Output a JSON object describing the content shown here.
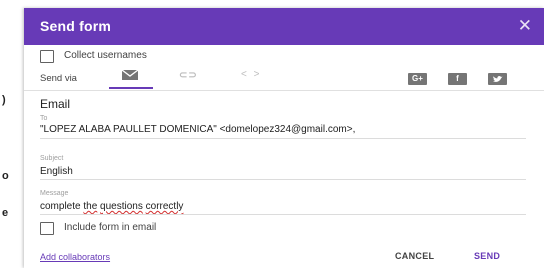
{
  "dialog": {
    "title": "Send form",
    "close_icon": "close-icon"
  },
  "collect_usernames": {
    "label": "Collect usernames",
    "checked": false
  },
  "send_via": {
    "label": "Send via",
    "tabs": [
      {
        "icon": "email-icon",
        "active": true
      },
      {
        "icon": "link-icon",
        "active": false
      },
      {
        "icon": "embed-icon",
        "active": false
      }
    ],
    "social": [
      {
        "icon": "google-plus-icon",
        "glyph": "G+"
      },
      {
        "icon": "facebook-icon",
        "glyph": "f"
      },
      {
        "icon": "twitter-icon",
        "glyph": ""
      }
    ]
  },
  "email": {
    "section_title": "Email",
    "to_label": "To",
    "to_value": "\"LOPEZ ALABA PAULLET DOMENICA\" <domelopez324@gmail.com>,",
    "subject_label": "Subject",
    "subject_value": "English",
    "message_label": "Message",
    "message_parts": [
      "complete ",
      "the",
      " ",
      "questions",
      " ",
      "correctly"
    ]
  },
  "include_form": {
    "label": "Include form in email",
    "checked": false
  },
  "footer": {
    "add_collaborators": "Add collaborators",
    "cancel_label": "CANCEL",
    "send_label": "SEND"
  },
  "colors": {
    "accent": "#673ab7",
    "header_bg": "#673ab7"
  }
}
